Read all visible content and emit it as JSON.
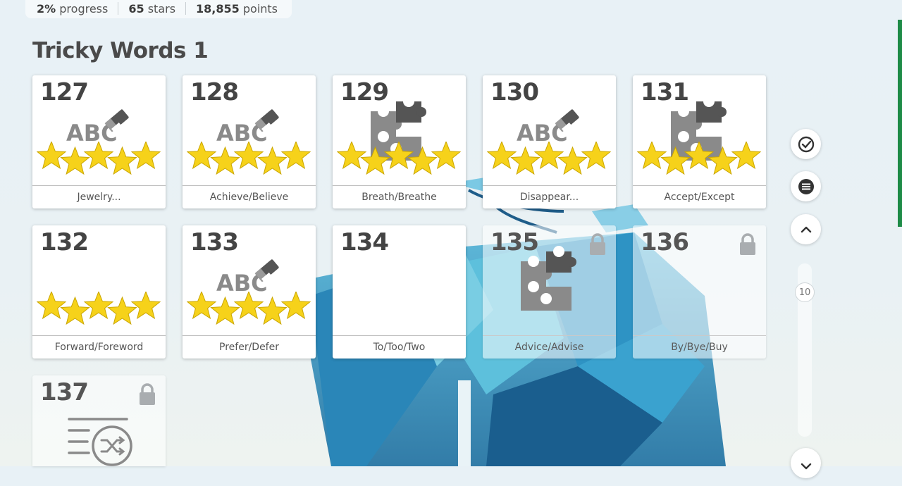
{
  "stats": {
    "progress_value": "2%",
    "progress_label": "progress",
    "stars_value": "65",
    "stars_label": "stars",
    "points_value": "18,855",
    "points_label": "points"
  },
  "section_title": "Tricky Words 1",
  "cards": [
    {
      "number": "127",
      "label": "Jewelry...",
      "type": "abc-eraser",
      "stars": 5,
      "locked": false
    },
    {
      "number": "128",
      "label": "Achieve/Believe",
      "type": "abc-eraser",
      "stars": 5,
      "locked": false
    },
    {
      "number": "129",
      "label": "Breath/Breathe",
      "type": "puzzle",
      "stars": 5,
      "locked": false
    },
    {
      "number": "130",
      "label": "Disappear...",
      "type": "abc-eraser",
      "stars": 5,
      "locked": false
    },
    {
      "number": "131",
      "label": "Accept/Except",
      "type": "puzzle",
      "stars": 5,
      "locked": false
    },
    {
      "number": "132",
      "label": "Forward/Foreword",
      "type": "audio",
      "stars": 5,
      "locked": false
    },
    {
      "number": "133",
      "label": "Prefer/Defer",
      "type": "abc-eraser",
      "stars": 5,
      "locked": false
    },
    {
      "number": "134",
      "label": "To/Too/Two",
      "type": "audio",
      "stars": 0,
      "locked": false
    },
    {
      "number": "135",
      "label": "Advice/Advise",
      "type": "puzzle",
      "stars": 0,
      "locked": true
    },
    {
      "number": "136",
      "label": "By/Bye/Buy",
      "type": "audio",
      "stars": 0,
      "locked": true
    },
    {
      "number": "137",
      "label": "",
      "type": "shuffle-list",
      "stars": 0,
      "locked": true
    }
  ],
  "icon_text": "ABC",
  "controls": {
    "check_icon": "check-circle-icon",
    "menu_icon": "menu-icon",
    "up_icon": "chevron-up-icon",
    "down_icon": "chevron-down-icon",
    "scroll_value": "10"
  },
  "colors": {
    "accent_green": "#1e8b47",
    "star_fill": "#f6d21a",
    "icon_gray": "#8a8a8a"
  }
}
